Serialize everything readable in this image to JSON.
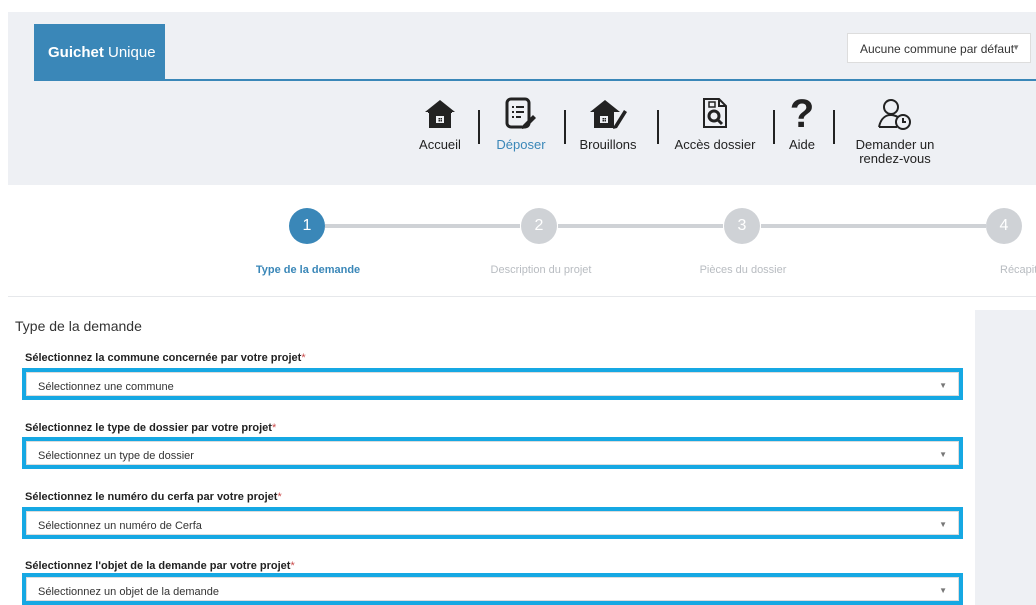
{
  "header": {
    "brand_bold": "Guichet",
    "brand_rest": " Unique",
    "commune_select": "Aucune commune par défaut",
    "nav": [
      {
        "label": "Accueil",
        "icon": "house-icon"
      },
      {
        "label": "Déposer",
        "icon": "document-edit-icon",
        "active": true
      },
      {
        "label": "Brouillons",
        "icon": "house-edit-icon"
      },
      {
        "label": "Accès dossier",
        "icon": "file-search-icon"
      },
      {
        "label": "Aide",
        "icon": "question-icon"
      },
      {
        "label_line1": "Demander un",
        "label_line2": "rendez-vous",
        "icon": "person-clock-icon"
      }
    ]
  },
  "stepper": {
    "steps": [
      {
        "number": "1",
        "label": "Type de la demande",
        "active": true
      },
      {
        "number": "2",
        "label": "Description du projet"
      },
      {
        "number": "3",
        "label": "Pièces du dossier"
      },
      {
        "number": "4",
        "label": "Récapitulatif"
      }
    ]
  },
  "form": {
    "title": "Type de la demande",
    "required_mark": "*",
    "fields": [
      {
        "label": "Sélectionnez la commune concernée par votre projet",
        "value": "Sélectionnez une commune"
      },
      {
        "label": "Sélectionnez le type de dossier par votre projet",
        "value": "Sélectionnez un type de dossier"
      },
      {
        "label": "Sélectionnez le numéro du cerfa par votre projet",
        "value": "Sélectionnez un numéro de Cerfa"
      },
      {
        "label": "Sélectionnez l'objet de la demande par votre projet",
        "value": "Sélectionnez un objet de la demande"
      }
    ]
  },
  "colors": {
    "primary": "#3a87b8",
    "highlight": "#16a8e3",
    "header_bg": "#eef0f4"
  }
}
